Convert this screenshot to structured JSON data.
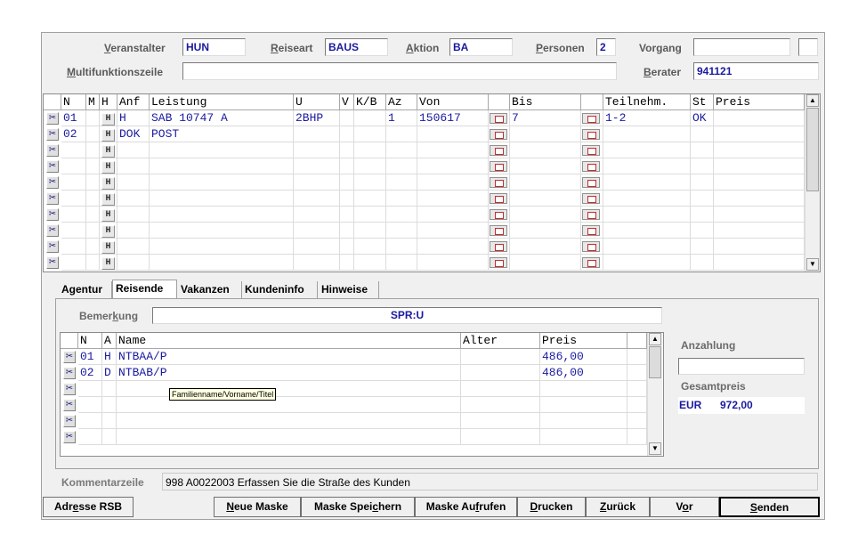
{
  "header": {
    "veranstalter": {
      "label_u": "V",
      "label_rest": "eranstalter",
      "value": "HUN"
    },
    "reiseart": {
      "label_u": "R",
      "label_rest": "eiseart",
      "value": "BAUS"
    },
    "aktion": {
      "label_u": "A",
      "label_rest": "ktion",
      "value": "BA"
    },
    "personen": {
      "label_u": "P",
      "label_rest": "ersonen",
      "value": "2"
    },
    "vorgang": {
      "label": "Vorgang",
      "value": "",
      "value2": ""
    },
    "multifunktion": {
      "label_u": "M",
      "label_rest": "ultifunktionszeile",
      "value": ""
    },
    "berater": {
      "label_u": "B",
      "label_rest": "erater",
      "value": "941121"
    }
  },
  "services_grid": {
    "headers": [
      "N",
      "M",
      "H",
      "Anf",
      "Leistung",
      "U",
      "V",
      "K/B",
      "Az",
      "Von",
      "",
      "Bis",
      "",
      "Teilnehm.",
      "St",
      "Preis"
    ],
    "rows": [
      {
        "n": "01",
        "m": "",
        "anf": "H",
        "leistung": "SAB 10747 A",
        "u": "2BHP",
        "v": "",
        "kb": "",
        "az": "1",
        "von": "150617",
        "bis": "7",
        "teilnehm": "1-2",
        "st": "OK",
        "preis": ""
      },
      {
        "n": "02",
        "m": "",
        "anf": "DOK",
        "leistung": "POST",
        "u": "",
        "v": "",
        "kb": "",
        "az": "",
        "von": "",
        "bis": "",
        "teilnehm": "",
        "st": "",
        "preis": ""
      },
      {
        "n": "",
        "m": "",
        "anf": "",
        "leistung": "",
        "u": "",
        "v": "",
        "kb": "",
        "az": "",
        "von": "",
        "bis": "",
        "teilnehm": "",
        "st": "",
        "preis": ""
      },
      {
        "n": "",
        "m": "",
        "anf": "",
        "leistung": "",
        "u": "",
        "v": "",
        "kb": "",
        "az": "",
        "von": "",
        "bis": "",
        "teilnehm": "",
        "st": "",
        "preis": ""
      },
      {
        "n": "",
        "m": "",
        "anf": "",
        "leistung": "",
        "u": "",
        "v": "",
        "kb": "",
        "az": "",
        "von": "",
        "bis": "",
        "teilnehm": "",
        "st": "",
        "preis": ""
      },
      {
        "n": "",
        "m": "",
        "anf": "",
        "leistung": "",
        "u": "",
        "v": "",
        "kb": "",
        "az": "",
        "von": "",
        "bis": "",
        "teilnehm": "",
        "st": "",
        "preis": ""
      },
      {
        "n": "",
        "m": "",
        "anf": "",
        "leistung": "",
        "u": "",
        "v": "",
        "kb": "",
        "az": "",
        "von": "",
        "bis": "",
        "teilnehm": "",
        "st": "",
        "preis": ""
      },
      {
        "n": "",
        "m": "",
        "anf": "",
        "leistung": "",
        "u": "",
        "v": "",
        "kb": "",
        "az": "",
        "von": "",
        "bis": "",
        "teilnehm": "",
        "st": "",
        "preis": ""
      },
      {
        "n": "",
        "m": "",
        "anf": "",
        "leistung": "",
        "u": "",
        "v": "",
        "kb": "",
        "az": "",
        "von": "",
        "bis": "",
        "teilnehm": "",
        "st": "",
        "preis": ""
      },
      {
        "n": "",
        "m": "",
        "anf": "",
        "leistung": "",
        "u": "",
        "v": "",
        "kb": "",
        "az": "",
        "von": "",
        "bis": "",
        "teilnehm": "",
        "st": "",
        "preis": ""
      }
    ],
    "h_button": "H",
    "scissors_glyph": "✂"
  },
  "tabs": [
    {
      "label": "Agentur",
      "active": false
    },
    {
      "label": "Reisende",
      "active": true
    },
    {
      "label": "Vakanzen",
      "active": false
    },
    {
      "label": "Kundeninfo",
      "active": false
    },
    {
      "label": "Hinweise",
      "active": false
    }
  ],
  "reisende": {
    "bemerkung_label_a": "Bemer",
    "bemerkung_label_u": "k",
    "bemerkung_label_b": "ung",
    "bemerkung_value": "SPR:U",
    "headers": [
      "N",
      "A",
      "Name",
      "Alter",
      "Preis"
    ],
    "rows": [
      {
        "n": "01",
        "a": "H",
        "name": "NTBAA/P",
        "alter": "",
        "preis": "486,00"
      },
      {
        "n": "02",
        "a": "D",
        "name": "NTBAB/P",
        "alter": "",
        "preis": "486,00"
      },
      {
        "n": "",
        "a": "",
        "name": "",
        "alter": "",
        "preis": ""
      },
      {
        "n": "",
        "a": "",
        "name": "",
        "alter": "",
        "preis": ""
      },
      {
        "n": "",
        "a": "",
        "name": "",
        "alter": "",
        "preis": ""
      },
      {
        "n": "",
        "a": "",
        "name": "",
        "alter": "",
        "preis": ""
      }
    ],
    "tooltip": "Familienname/Vorname/Titel",
    "anzahlung_label": "Anzahlung",
    "anzahlung_value": "",
    "gesamtpreis_label": "Gesamtpreis",
    "currency": "EUR",
    "gesamtpreis_value": "972,00"
  },
  "kommentar": {
    "label": "Kommentarzeile",
    "value": "998 A0022003 Erfassen Sie die Straße des Kunden"
  },
  "buttons": {
    "adresse": {
      "a": "Adr",
      "u": "e",
      "b": "sse RSB"
    },
    "neue_maske": {
      "a": "",
      "u": "N",
      "b": "eue Maske"
    },
    "maske_speichern": {
      "a": "Maske Spei",
      "u": "c",
      "b": "hern"
    },
    "maske_aufrufen": {
      "a": "Maske Au",
      "u": "f",
      "b": "rufen"
    },
    "drucken": {
      "a": "",
      "u": "D",
      "b": "rucken"
    },
    "zurueck": {
      "a": "",
      "u": "Z",
      "b": "urück"
    },
    "vor": {
      "a": "V",
      "u": "o",
      "b": "r"
    },
    "senden": {
      "a": "",
      "u": "S",
      "b": "enden"
    }
  },
  "colors": {
    "value_text": "#1a1aa0",
    "label_text": "#5a5a5a",
    "background": "#f0f0f0"
  }
}
